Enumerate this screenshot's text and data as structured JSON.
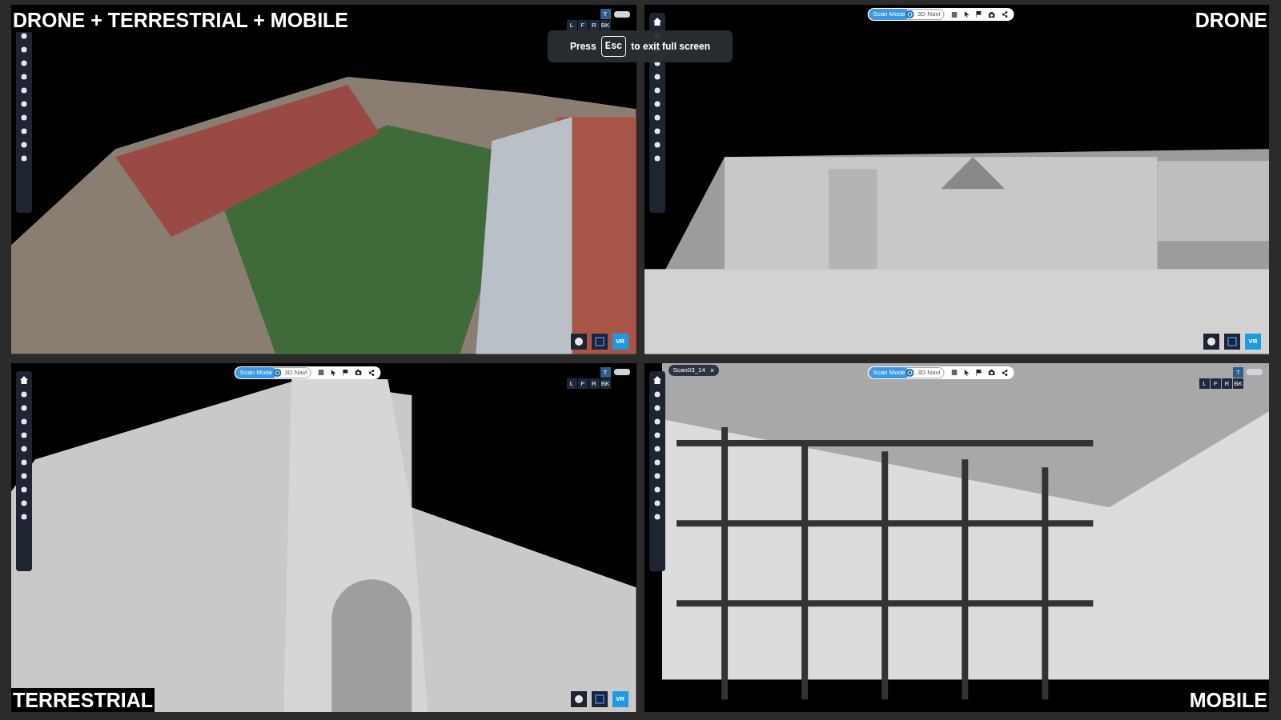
{
  "panels": [
    {
      "label": "DRONE + TERRESTRIAL + MOBILE",
      "view_cube": {
        "top": "T",
        "row": [
          "L",
          "F",
          "R",
          "BK"
        ]
      },
      "bottom_buttons": {
        "vr": "VR"
      }
    },
    {
      "label": "DRONE",
      "mode_bar": {
        "scan": "Scan Mode",
        "navi": "3D Navi"
      },
      "bottom_buttons": {
        "vr": "VR"
      }
    },
    {
      "label": "TERRESTRIAL",
      "mode_bar": {
        "scan": "Scan Mode",
        "navi": "3D Navi"
      },
      "view_cube": {
        "top": "T",
        "row": [
          "L",
          "F",
          "R",
          "BK"
        ]
      },
      "bottom_buttons": {
        "vr": "VR"
      }
    },
    {
      "label": "MOBILE",
      "mode_bar": {
        "scan": "Scan Mode",
        "navi": "3D Navi"
      },
      "view_cube": {
        "top": "T",
        "row": [
          "L",
          "F",
          "R",
          "BK"
        ]
      },
      "scan_tag": {
        "text": "Scan03_14",
        "close": "×"
      }
    }
  ],
  "fullscreen_notice": {
    "before": "Press",
    "key": "Esc",
    "after": "to exit full screen"
  }
}
